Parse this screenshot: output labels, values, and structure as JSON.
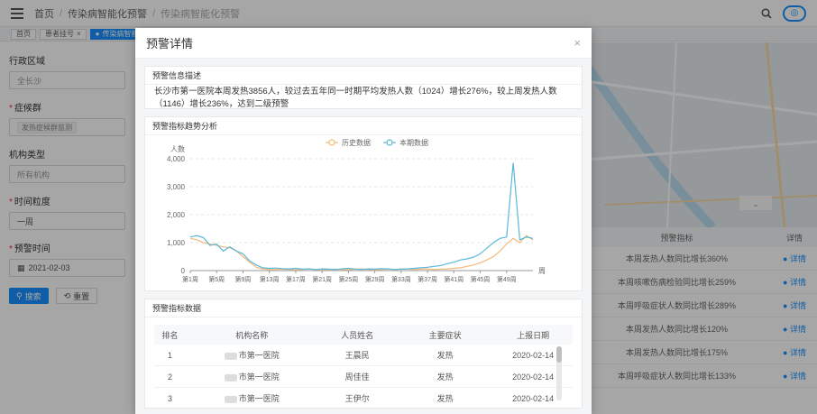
{
  "topbar": {
    "breadcrumb": [
      "首页",
      "传染病智能化预警",
      "传染病智能化预警"
    ]
  },
  "tabs": [
    {
      "label": "首页"
    },
    {
      "label": "患者挂号"
    },
    {
      "label": "传染病智能化预警"
    }
  ],
  "filters": {
    "region_label": "行政区域",
    "region_placeholder": "全长沙",
    "disease_label": "症候群",
    "disease_tag": "发热症候群监测",
    "org_type_label": "机构类型",
    "org_type_placeholder": "所有机构",
    "granularity_label": "时间粒度",
    "granularity_value": "一周",
    "warn_time_label": "预警时间",
    "warn_time_value": "2021-02-03",
    "search_btn": "搜索",
    "reset_btn": "重置"
  },
  "bg_table": {
    "headers": [
      "预警指标",
      "详情"
    ],
    "rows": [
      {
        "indicator": "本周发热人数同比增长360%",
        "detail": "详情"
      },
      {
        "indicator": "本周咳嗽伤病检验同比增长259%",
        "detail": "详情"
      },
      {
        "indicator": "本周呼吸症状人数同比增长289%",
        "detail": "详情"
      },
      {
        "indicator": "本周发热人数同比增长120%",
        "detail": "详情"
      },
      {
        "indicator": "本周发热人数同比增长175%",
        "detail": "详情"
      },
      {
        "indicator": "本周呼吸症状人数同比增长133%",
        "detail": "详情"
      }
    ]
  },
  "modal": {
    "title": "预警详情",
    "close": "×",
    "summary_title": "预警信息描述",
    "summary_text": "长沙市第一医院本周发热3856人，较过去五年同一时期平均发热人数（1024）增长276%，较上周发热人数（1146）增长236%，达到二级预警",
    "chart_title": "预警指标趋势分析",
    "table_title": "预警指标数据",
    "table_headers": [
      "排名",
      "机构名称",
      "人员姓名",
      "主要症状",
      "上报日期"
    ],
    "table_rows": [
      {
        "idx": "1",
        "org": "市第一医院",
        "person": "王晨民",
        "symptom": "发热",
        "date": "2020-02-14"
      },
      {
        "idx": "2",
        "org": "市第一医院",
        "person": "周佳佳",
        "symptom": "发热",
        "date": "2020-02-14"
      },
      {
        "idx": "3",
        "org": "市第一医院",
        "person": "王伊尔",
        "symptom": "发热",
        "date": "2020-02-14"
      }
    ]
  },
  "chart_data": {
    "type": "line",
    "title": "",
    "xlabel": "周",
    "ylabel": "人数",
    "ylim": [
      0,
      4000
    ],
    "yticks": [
      0,
      1000,
      2000,
      3000,
      4000
    ],
    "ytick_labels": [
      "0",
      "1,000",
      "2,000",
      "3,000",
      "4,000"
    ],
    "xtick_labels": [
      "第1周",
      "第5周",
      "第9周",
      "第13周",
      "第17周",
      "第21周",
      "第25周",
      "第29周",
      "第33周",
      "第37周",
      "第41周",
      "第45周",
      "第49周"
    ],
    "legend": [
      "历史数据",
      "本期数据"
    ],
    "grid": true,
    "series": [
      {
        "name": "历史数据",
        "color": "#f5b97a",
        "values": [
          1150,
          1100,
          1000,
          950,
          900,
          850,
          820,
          700,
          500,
          300,
          120,
          60,
          40,
          40,
          50,
          40,
          30,
          40,
          60,
          40,
          30,
          40,
          50,
          40,
          30,
          50,
          60,
          40,
          30,
          40,
          50,
          40,
          60,
          50,
          40,
          50,
          60,
          40,
          50,
          60,
          80,
          100,
          150,
          200,
          280,
          380,
          500,
          700,
          950,
          1150,
          1000,
          1250,
          1100
        ]
      },
      {
        "name": "本期数据",
        "color": "#57b8d9",
        "values": [
          1200,
          1250,
          1180,
          900,
          950,
          700,
          850,
          700,
          600,
          350,
          200,
          100,
          80,
          90,
          70,
          60,
          80,
          50,
          60,
          40,
          60,
          50,
          40,
          60,
          80,
          50,
          40,
          60,
          50,
          70,
          60,
          40,
          50,
          60,
          80,
          100,
          120,
          150,
          180,
          250,
          300,
          380,
          420,
          480,
          600,
          800,
          1000,
          1150,
          1200,
          3856,
          1100,
          1200,
          1150
        ]
      }
    ]
  }
}
